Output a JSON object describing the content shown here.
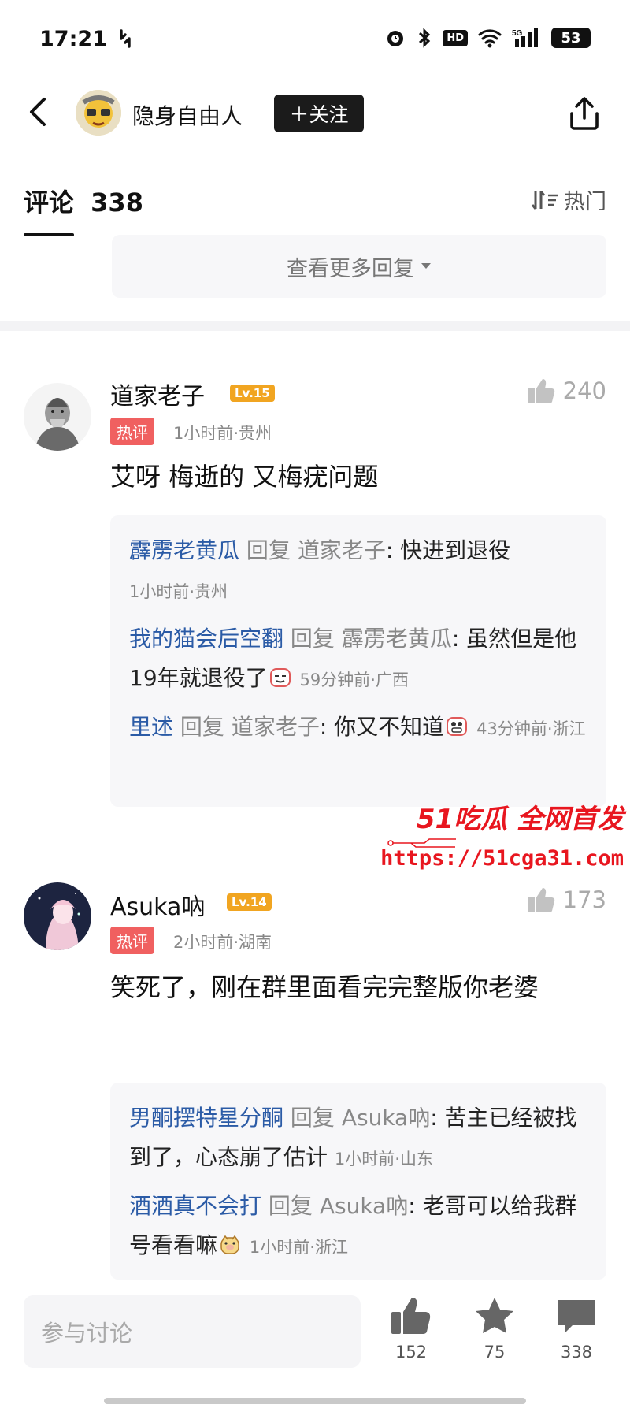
{
  "status_bar": {
    "time": "17:21",
    "signal_label": "5G",
    "hd_label": "HD",
    "battery": "53"
  },
  "header": {
    "author_name": "隐身自由人",
    "follow_label": "＋关注"
  },
  "comments_header": {
    "label": "评论",
    "count": "338",
    "sort_label": "热门"
  },
  "see_more_replies": "查看更多回复",
  "comments": [
    {
      "user": "道家老子",
      "level": "Lv.15",
      "likes": "240",
      "hot_label": "热评",
      "meta": "1小时前·贵州",
      "text": "艾呀 梅逝的 又梅疣问题",
      "replies": [
        {
          "user": "霹雳老黄瓜",
          "mid": " 回复 ",
          "target": "道家老子",
          "text": ": 快进到退役",
          "meta": "1小时前·贵州"
        },
        {
          "user": "我的猫会后空翻",
          "mid": " 回复 ",
          "target": "霹雳老黄瓜",
          "text": ": 虽然但是他19年就退役了",
          "meta": "59分钟前·广西"
        },
        {
          "user": "里述",
          "mid": " 回复 ",
          "target": "道家老子",
          "text": ": 你又不知道",
          "meta": "43分钟前·浙江"
        }
      ]
    },
    {
      "user": "Asuka吶",
      "level": "Lv.14",
      "likes": "173",
      "hot_label": "热评",
      "meta": "2小时前·湖南",
      "text": "笑死了，刚在群里面看完完整版你老婆",
      "replies": [
        {
          "user": "男酮摆特星分酮",
          "mid": " 回复 ",
          "target": "Asuka吶",
          "text": ": 苦主已经被找到了，心态崩了估计",
          "meta": "1小时前·山东"
        },
        {
          "user": "酒酒真不会打",
          "mid": " 回复 ",
          "target": "Asuka吶",
          "text": ": 老哥可以给我群号看看嘛",
          "meta": "1小时前·浙江"
        }
      ]
    }
  ],
  "watermark": {
    "line1": "51吃瓜 全网首发",
    "line2": "https://51cga31.com"
  },
  "bottom_bar": {
    "input_placeholder": "参与讨论",
    "like_count": "152",
    "favorite_count": "75",
    "comment_count": "338"
  },
  "colors": {
    "reply_user": "#2b5ba6",
    "hot_badge": "#f06060",
    "level_badge": "#f1a521",
    "watermark": "#e8161f"
  }
}
